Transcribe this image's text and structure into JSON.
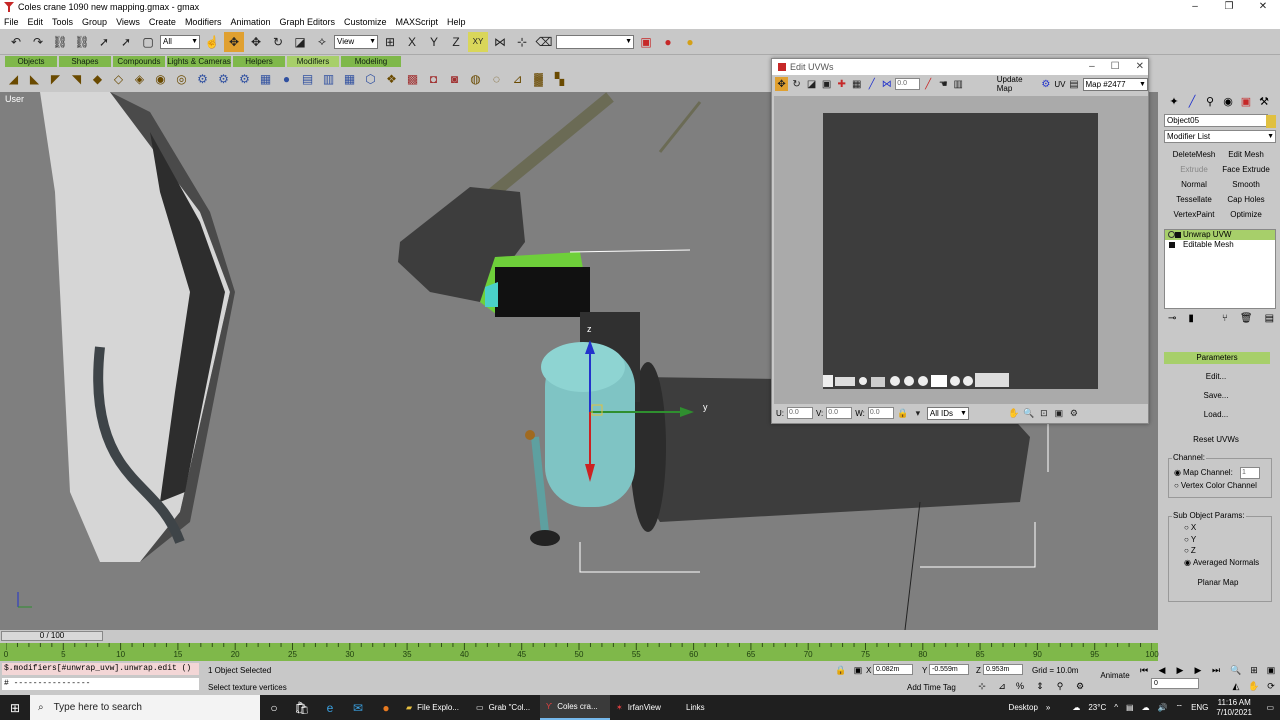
{
  "window": {
    "title": "Coles crane 1090 new mapping.gmax - gmax"
  },
  "menu": [
    "File",
    "Edit",
    "Tools",
    "Group",
    "Views",
    "Create",
    "Modifiers",
    "Animation",
    "Graph Editors",
    "Customize",
    "MAXScript",
    "Help"
  ],
  "toolbar": {
    "selection_filter": "All",
    "ref_coord": "View",
    "axis_constraint": "XY"
  },
  "tabs": [
    "Objects",
    "Shapes",
    "Compounds",
    "Lights & Cameras",
    "Helpers",
    "Modifiers",
    "Modeling"
  ],
  "selected_tab": "Modifiers",
  "viewport": {
    "label": "User",
    "gizmo_z": "z",
    "gizmo_y": "y"
  },
  "uvw_editor": {
    "title": "Edit UVWs",
    "spinner": "0.0",
    "update_map": "Update Map",
    "uvw_label": "UV",
    "map_select": "Map #2477",
    "u_label": "U:",
    "v_label": "V:",
    "w_label": "W:",
    "u_value": "0.0",
    "v_value": "0.0",
    "w_value": "0.0",
    "ids_select": "All IDs"
  },
  "command_panel": {
    "object_name": "Object05",
    "modifier_list": "Modifier List",
    "modifier_buttons": [
      {
        "label": "DeleteMesh",
        "dim": false
      },
      {
        "label": "Edit Mesh",
        "dim": false
      },
      {
        "label": "Extrude",
        "dim": true
      },
      {
        "label": "Face Extrude",
        "dim": false
      },
      {
        "label": "Normal",
        "dim": false
      },
      {
        "label": "Smooth",
        "dim": false
      },
      {
        "label": "Tessellate",
        "dim": false
      },
      {
        "label": "Cap Holes",
        "dim": false
      },
      {
        "label": "VertexPaint",
        "dim": false
      },
      {
        "label": "Optimize",
        "dim": false
      }
    ],
    "stack": [
      "Unwrap UVW",
      "Editable Mesh"
    ],
    "rollout": "Parameters",
    "edit_button": "Edit...",
    "save_button": "Save...",
    "load_button": "Load...",
    "reset_button": "Reset UVWs",
    "channel_label": "Channel:",
    "map_channel": "Map Channel:",
    "map_channel_value": "1",
    "vertex_color_channel": "Vertex Color Channel",
    "subobject_label": "Sub Object Params:",
    "axes": [
      "X",
      "Y",
      "Z",
      "Averaged Normals"
    ],
    "planar_map": "Planar Map"
  },
  "timeline": {
    "slider": "0 / 100",
    "ticks": [
      "0",
      "5",
      "10",
      "15",
      "20",
      "25",
      "30",
      "35",
      "40",
      "45",
      "50",
      "55",
      "60",
      "65",
      "70",
      "75",
      "80",
      "85",
      "90",
      "95",
      "100"
    ]
  },
  "status": {
    "maxscript_line1": "$.modifiers[#unwrap_uvw].unwrap.edit ()",
    "maxscript_line2": "# ----------------",
    "selection": "1 Object Selected",
    "prompt": "Select texture vertices",
    "x": "0.082m",
    "y": "-0.559m",
    "z": "0.953m",
    "x_label": "X",
    "y_label": "Y",
    "z_label": "Z",
    "grid": "Grid = 10.0m",
    "add_time_tag": "Add Time Tag",
    "animate": "Animate",
    "frame": "0"
  },
  "taskbar": {
    "search": "Type here to search",
    "apps": [
      {
        "label": "File Explo...",
        "active": false
      },
      {
        "label": "Grab \"Col...",
        "active": false
      },
      {
        "label": "Coles cra...",
        "active": true
      },
      {
        "label": "IrfanView",
        "active": false
      }
    ],
    "links": "Links",
    "desktop": "Desktop",
    "temperature": "23°C",
    "language": "ENG",
    "time": "11:16 AM",
    "date": "7/10/2021"
  },
  "colors": {
    "accent_green": "#7fb84a",
    "active_orange": "#e0a030",
    "viewport_bg": "#7f7f7f"
  }
}
